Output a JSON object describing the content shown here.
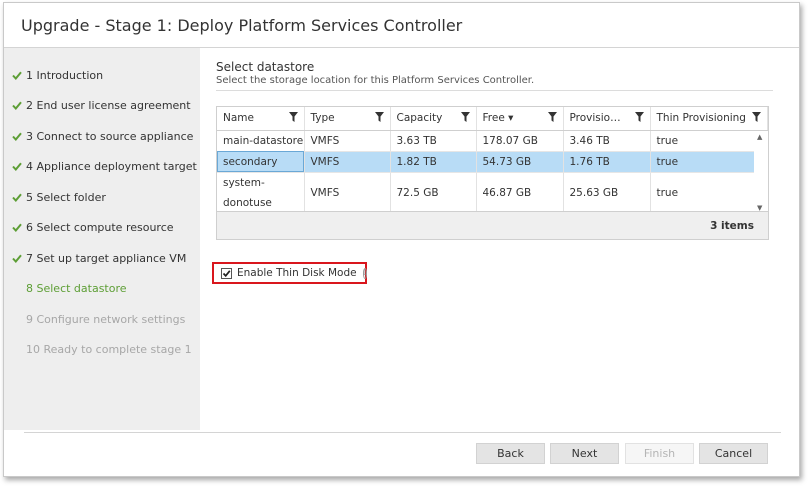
{
  "title": "Upgrade - Stage 1: Deploy Platform Services Controller",
  "steps": [
    {
      "label": "1 Introduction",
      "state": "done"
    },
    {
      "label": "2 End user license agreement",
      "state": "done"
    },
    {
      "label": "3 Connect to source appliance",
      "state": "done"
    },
    {
      "label": "4 Appliance deployment target",
      "state": "done"
    },
    {
      "label": "5 Select folder",
      "state": "done"
    },
    {
      "label": "6 Select compute resource",
      "state": "done"
    },
    {
      "label": "7 Set up target appliance VM",
      "state": "done"
    },
    {
      "label": "8 Select datastore",
      "state": "active"
    },
    {
      "label": "9 Configure network settings",
      "state": "future"
    },
    {
      "label": "10 Ready to complete stage 1",
      "state": "future"
    }
  ],
  "section": {
    "title": "Select datastore",
    "subtitle": "Select the storage location for this Platform Services Controller."
  },
  "table": {
    "columns": [
      "Name",
      "Type",
      "Capacity",
      "Free ▾",
      "Provisio…",
      "Thin Provisioning"
    ],
    "rows": [
      [
        "main-datastore",
        "VMFS",
        "3.63 TB",
        "178.07 GB",
        "3.46 TB",
        "true"
      ],
      [
        "secondary",
        "VMFS",
        "1.82 TB",
        "54.73 GB",
        "1.76 TB",
        "true"
      ],
      [
        "system-donotuse",
        "VMFS",
        "72.5 GB",
        "46.87 GB",
        "25.63 GB",
        "true"
      ]
    ],
    "selected_row": 1,
    "items_count": "3 items"
  },
  "thin_disk": {
    "label": "Enable Thin Disk Mode",
    "checked": true,
    "info_glyph": "i"
  },
  "buttons": {
    "back": "Back",
    "next": "Next",
    "finish": "Finish",
    "cancel": "Cancel"
  },
  "colors": {
    "done_check": "#5d9e35",
    "active_step": "#5d9e35",
    "selected_row": "#b8dcf6",
    "highlight_border": "#d9161d"
  },
  "icons": {
    "done": "checkmark-icon",
    "filter": "filter-funnel-icon",
    "info": "info-circle-icon"
  }
}
